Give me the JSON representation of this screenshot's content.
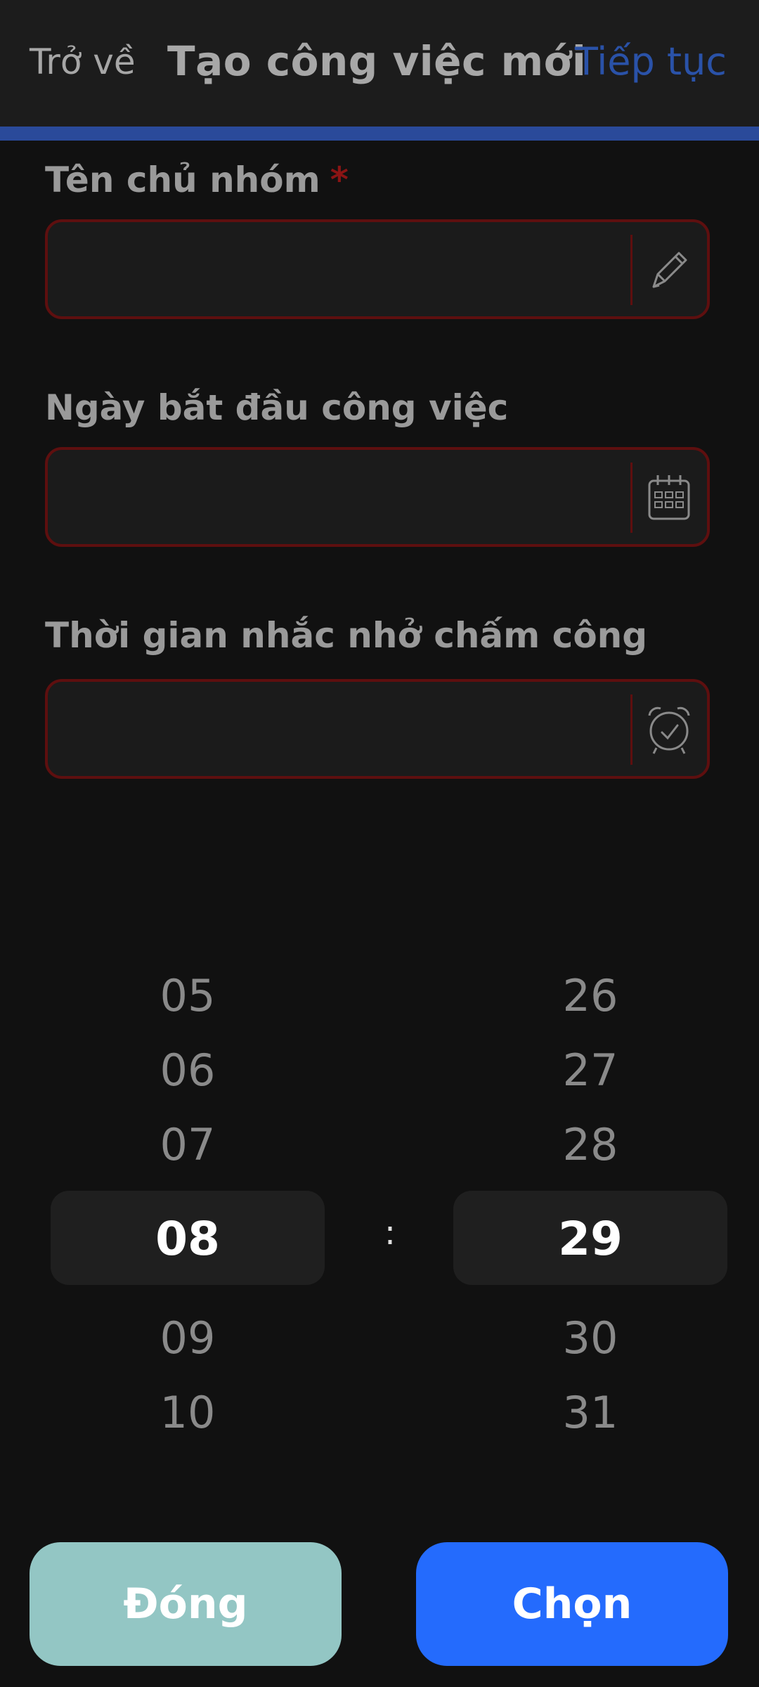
{
  "header": {
    "back_label": "Trở về",
    "title": "Tạo công việc mới",
    "next_label": "Tiếp tục"
  },
  "form": {
    "group_owner_label": "Tên chủ nhóm",
    "required_mark": "*",
    "group_owner_value": "",
    "start_date_label": "Ngày bắt đầu công việc",
    "start_date_value": "",
    "reminder_label": "Thời gian nhắc nhở chấm công",
    "reminder_value": ""
  },
  "time_picker": {
    "hours": [
      "05",
      "06",
      "07",
      "08",
      "09",
      "10"
    ],
    "minutes": [
      "26",
      "27",
      "28",
      "29",
      "30",
      "31"
    ],
    "selected_hour": "08",
    "selected_minute": "29",
    "separator": ":"
  },
  "actions": {
    "close_label": "Đóng",
    "select_label": "Chọn"
  },
  "colors": {
    "accent": "#246bfd",
    "close_button": "#93c6c4",
    "error_border": "#5e0f0f",
    "header_link": "#2a52a8"
  },
  "icons": {
    "field1": "pencil-icon",
    "field2": "calendar-icon",
    "field3": "alarm-clock-icon"
  }
}
